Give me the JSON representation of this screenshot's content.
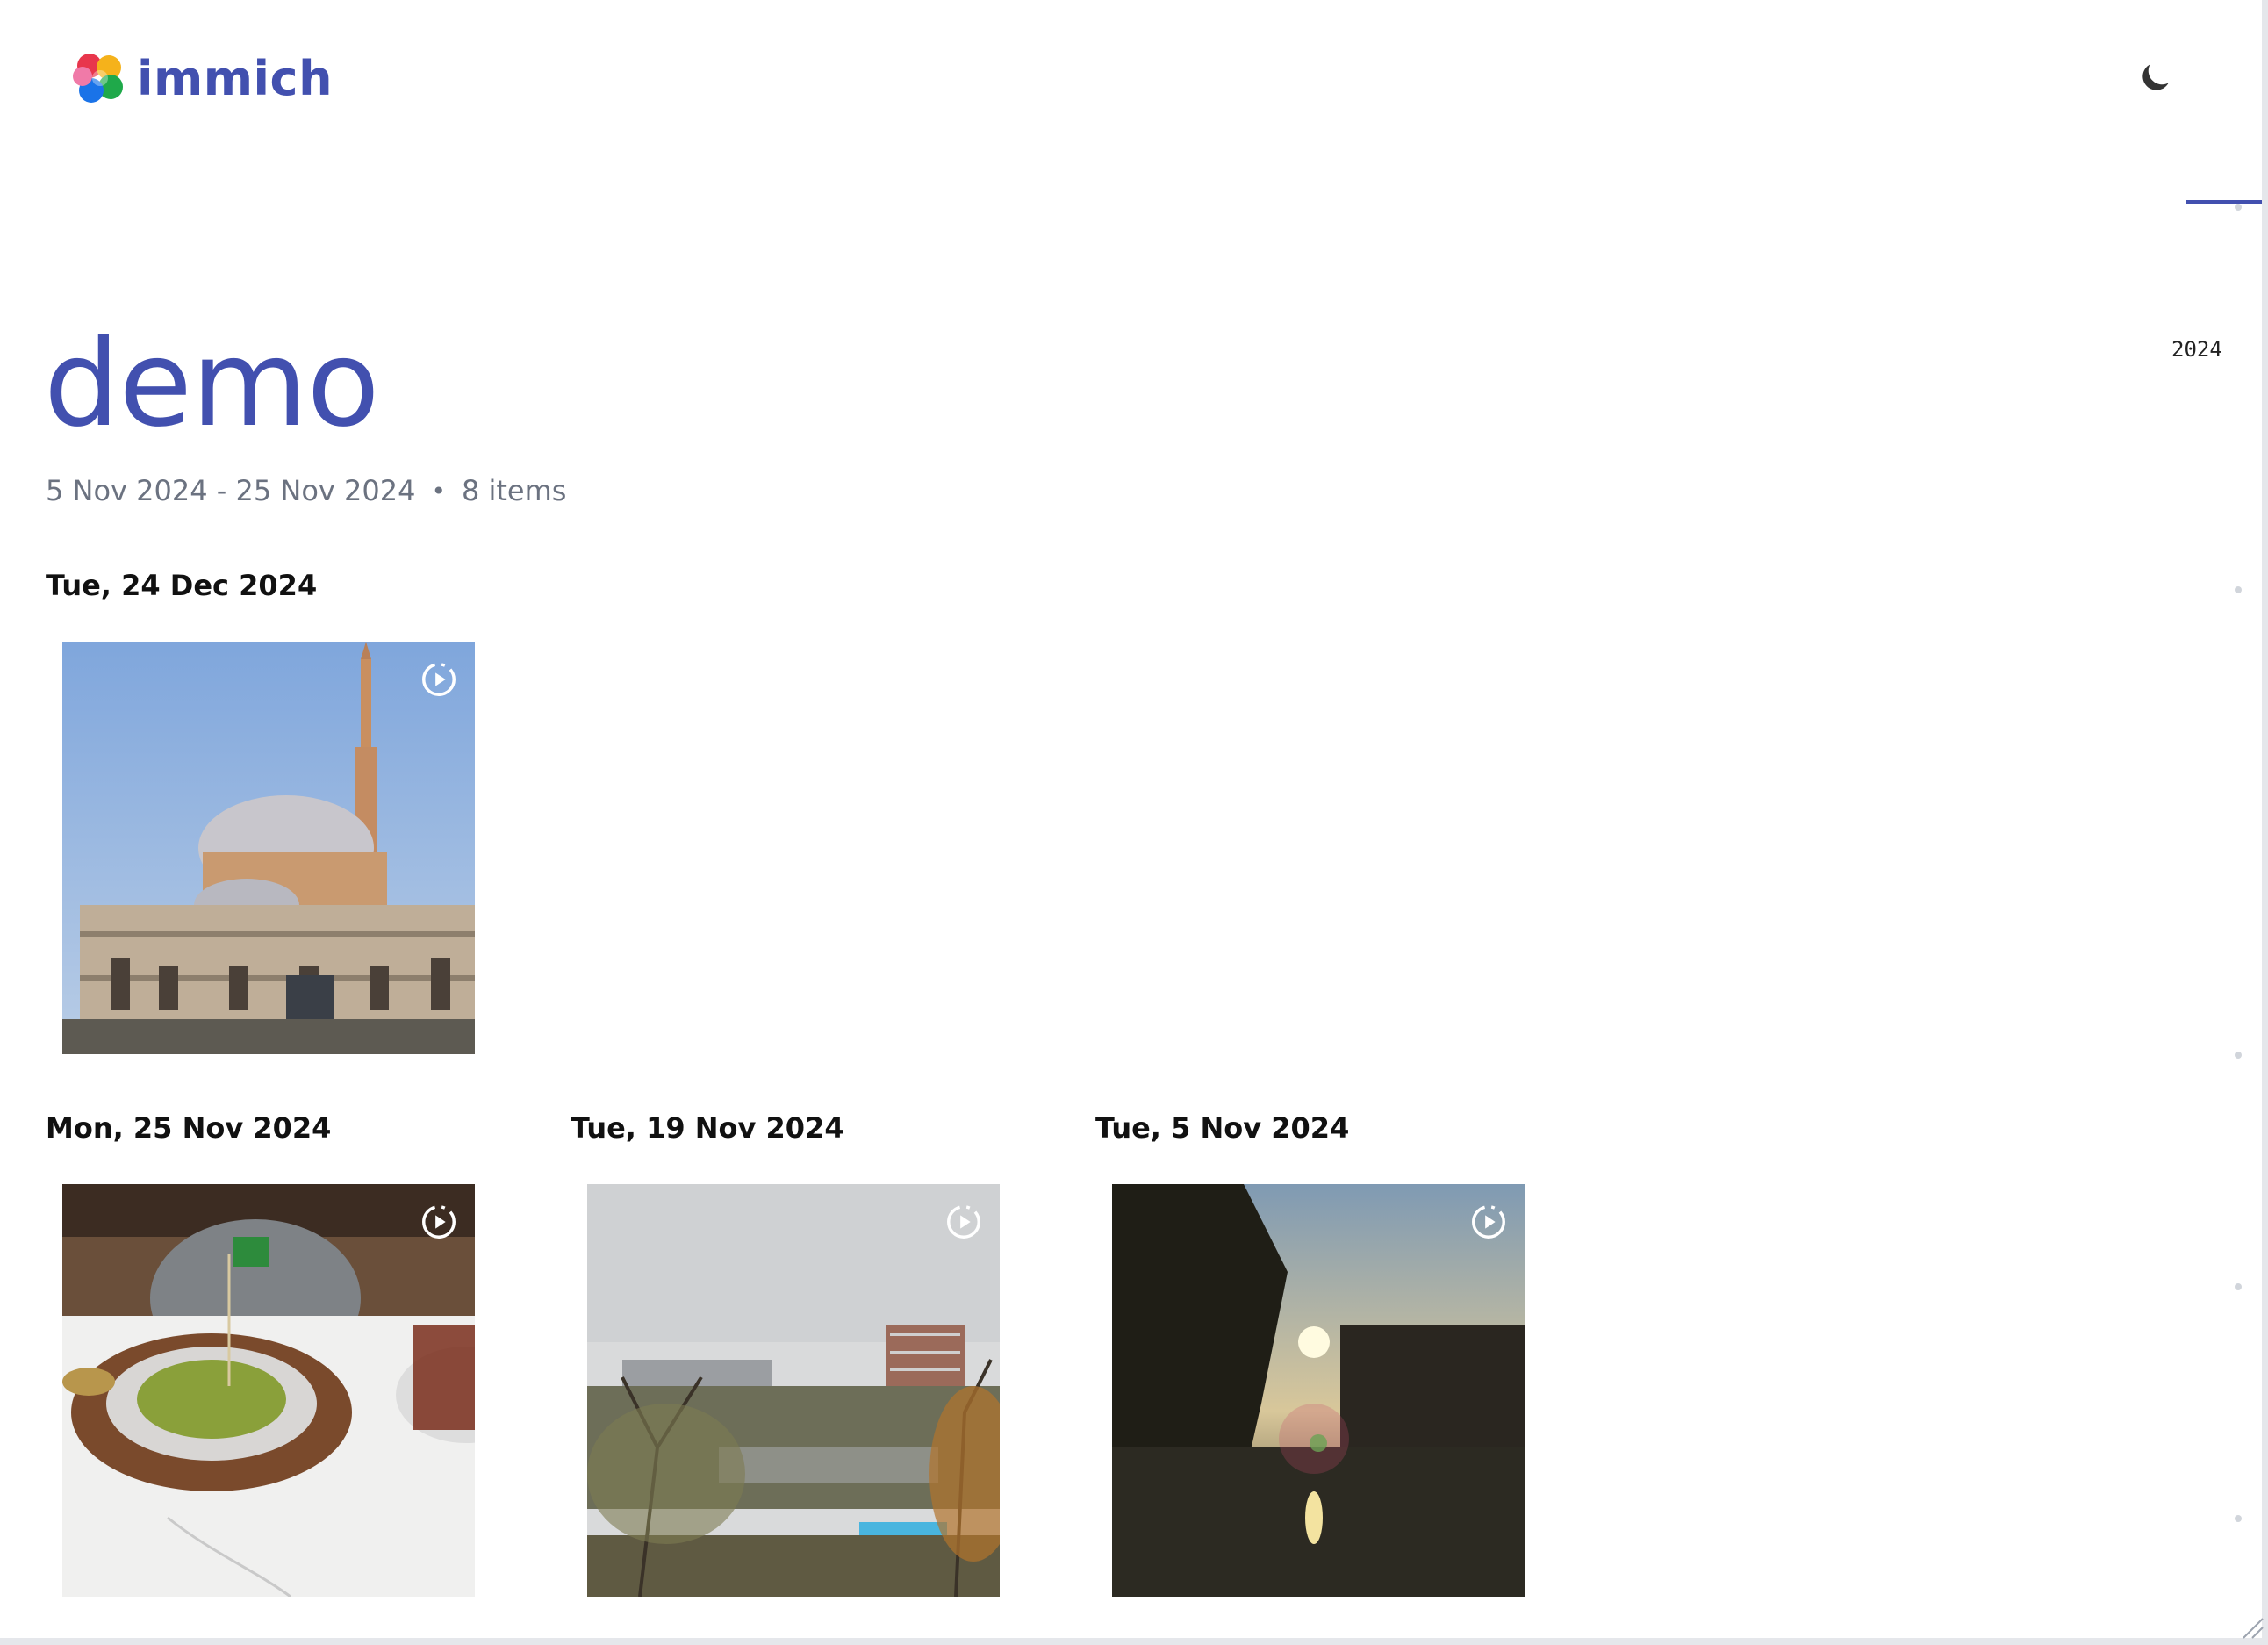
{
  "app": {
    "name": "immich"
  },
  "album": {
    "title": "demo",
    "date_range": "5 Nov 2024 - 25 Nov 2024",
    "separator": "•",
    "item_count": "8 items"
  },
  "groups": [
    {
      "date": "Tue, 24 Dec 2024",
      "photo": "mosque-photo"
    },
    {
      "date": "Mon, 25 Nov 2024",
      "photo": "pistachio-dessert-photo"
    },
    {
      "date": "Tue, 19 Nov 2024",
      "photo": "cloudy-city-photo"
    },
    {
      "date": "Tue, 5 Nov 2024",
      "photo": "sunset-river-photo"
    }
  ],
  "scrubber": {
    "year_label": "2024",
    "accent": "#4250af"
  },
  "colors": {
    "brand": "#4250af",
    "muted": "#6b7280"
  },
  "icons": {
    "theme": "moon-icon",
    "motion": "motion-photo-icon"
  }
}
